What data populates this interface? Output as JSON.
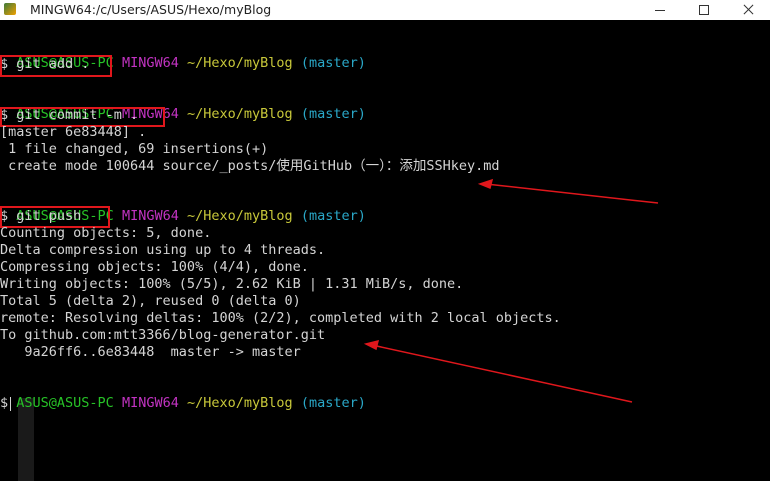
{
  "window": {
    "title": "MINGW64:/c/Users/ASUS/Hexo/myBlog"
  },
  "terminal": {
    "prompt": {
      "user": "ASUS@ASUS-PC",
      "shell": "MINGW64",
      "path": "~/Hexo/myBlog",
      "branch": "(master)",
      "symbol": "$"
    },
    "commands": {
      "add": " git add .",
      "commit": " git commit -m .",
      "push": " git push"
    },
    "commit_output": [
      "[master 6e83448] .",
      " 1 file changed, 69 insertions(+)",
      " create mode 100644 source/_posts/使用GitHub（一）：添加SSHkey.md"
    ],
    "push_output": [
      "Counting objects: 5, done.",
      "Delta compression using up to 4 threads.",
      "Compressing objects: 100% (4/4), done.",
      "Writing objects: 100% (5/5), 2.62 KiB | 1.31 MiB/s, done.",
      "Total 5 (delta 2), reused 0 (delta 0)",
      "remote: Resolving deltas: 100% (2/2), completed with 2 local objects.",
      "To github.com:mtt3366/blog-generator.git",
      "   9a26ff6..6e83448  master -> master"
    ]
  },
  "colors": {
    "prompt_user": "#27c227",
    "prompt_shell": "#c233c2",
    "prompt_path": "#c8c83a",
    "prompt_branch": "#2aa8c8",
    "highlight": "#e0171c"
  }
}
